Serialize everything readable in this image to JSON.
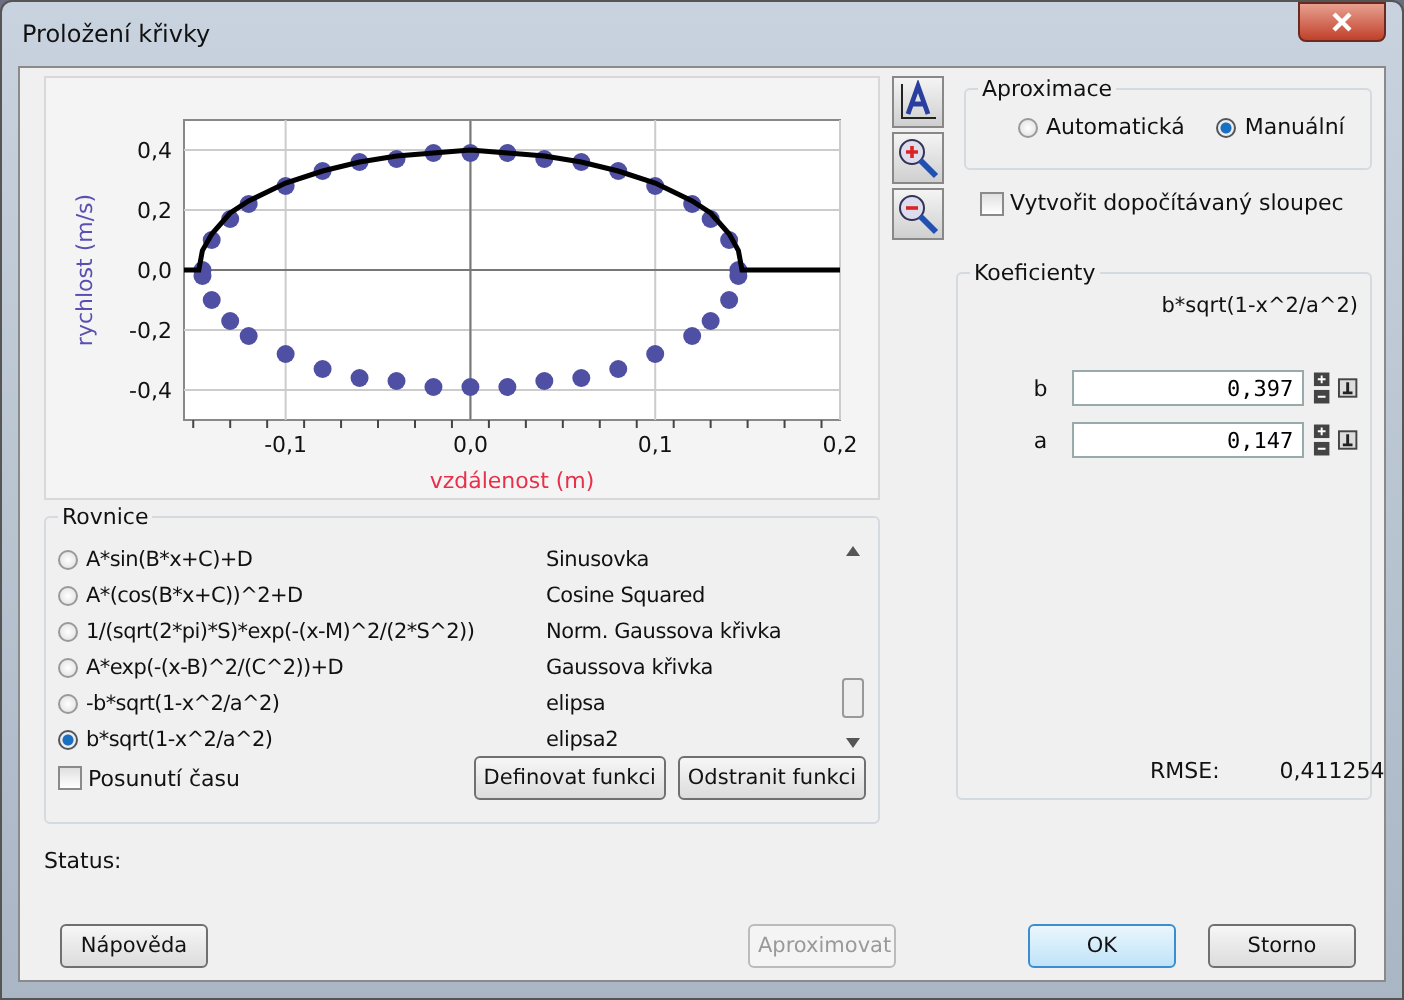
{
  "window": {
    "title": "Proložení křivky"
  },
  "plot": {
    "chart_data": {
      "type": "scatter",
      "grid": true,
      "xlabel": "vzdálenost (m)",
      "ylabel": "rychlost (m/s)",
      "xlim": [
        -0.155,
        0.2
      ],
      "ylim": [
        -0.5,
        0.5
      ],
      "xticks": [
        {
          "value": -0.1,
          "label": "-0,1"
        },
        {
          "value": 0,
          "label": "0,0"
        },
        {
          "value": 0.1,
          "label": "0,1"
        },
        {
          "value": 0.2,
          "label": "0,2"
        }
      ],
      "yticks": [
        {
          "value": -0.4,
          "label": "-0,4"
        },
        {
          "value": -0.2,
          "label": "-0,2"
        },
        {
          "value": 0,
          "label": "0,0"
        },
        {
          "value": 0.2,
          "label": "0,2"
        },
        {
          "value": 0.4,
          "label": "0,4"
        }
      ],
      "x": [
        -0.155,
        -0.147,
        -0.145,
        -0.14,
        -0.13,
        -0.12,
        -0.1,
        -0.08,
        -0.06,
        -0.04,
        -0.02,
        0,
        0.02,
        0.04,
        0.06,
        0.08,
        0.1,
        0.12,
        0.13,
        0.14,
        0.145,
        0.147,
        0.2
      ],
      "series": [
        {
          "type": "scatter",
          "color": "#4f4fa3",
          "values": [
            null,
            null,
            0,
            0.1,
            0.17,
            0.22,
            0.28,
            0.33,
            0.36,
            0.37,
            0.39,
            0.39,
            0.39,
            0.37,
            0.36,
            0.33,
            0.28,
            0.22,
            0.17,
            0.1,
            0,
            null,
            null
          ]
        },
        {
          "type": "scatter",
          "color": "#4f4fa3",
          "values": [
            null,
            null,
            -0.02,
            -0.1,
            -0.17,
            -0.22,
            -0.28,
            -0.33,
            -0.36,
            -0.37,
            -0.39,
            -0.39,
            -0.39,
            -0.37,
            -0.36,
            -0.33,
            -0.28,
            -0.22,
            -0.17,
            -0.1,
            -0.02,
            null,
            null
          ]
        },
        {
          "type": "line",
          "color": "#000000",
          "values": [
            0,
            0,
            0.065,
            0.12,
            0.19,
            0.23,
            0.29,
            0.33,
            0.36,
            0.38,
            0.39,
            0.4,
            0.39,
            0.38,
            0.36,
            0.33,
            0.29,
            0.23,
            0.19,
            0.12,
            0.065,
            0,
            0
          ]
        }
      ]
    }
  },
  "approximation": {
    "title": "Aproximace",
    "options": [
      {
        "label": "Automatická",
        "selected": false
      },
      {
        "label": "Manuální",
        "selected": true
      }
    ]
  },
  "create_column": {
    "label": "Vytvořit dopočítávaný sloupec",
    "checked": false
  },
  "coefficients": {
    "title": "Koeficienty",
    "formula": "b*sqrt(1-x^2/a^2)",
    "items": [
      {
        "name": "b",
        "value": "0,397"
      },
      {
        "name": "a",
        "value": "0,147"
      }
    ],
    "rmse_label": "RMSE:",
    "rmse_value": "0,411254"
  },
  "equations": {
    "title": "Rovnice",
    "items": [
      {
        "formula": "A*sin(B*x+C)+D",
        "name": "Sinusovka",
        "selected": false
      },
      {
        "formula": "A*(cos(B*x+C))^2+D",
        "name": "Cosine Squared",
        "selected": false
      },
      {
        "formula": "1/(sqrt(2*pi)*S)*exp(-(x-M)^2/(2*S^2))",
        "name": "Norm. Gaussova křivka",
        "selected": false
      },
      {
        "formula": "A*exp(-(x-B)^2/(C^2))+D",
        "name": "Gaussova křivka",
        "selected": false
      },
      {
        "formula": "-b*sqrt(1-x^2/a^2)",
        "name": "elipsa",
        "selected": false
      },
      {
        "formula": "b*sqrt(1-x^2/a^2)",
        "name": "elipsa2",
        "selected": true
      }
    ],
    "time_shift": {
      "label": "Posunutí času",
      "checked": false
    },
    "buttons": [
      "Definovat funkci",
      "Odstranit funkci"
    ]
  },
  "status": {
    "label": "Status:"
  },
  "buttons": [
    {
      "label": "Nápověda",
      "disabled": false,
      "default": false
    },
    {
      "label": "Aproximovat",
      "disabled": true,
      "default": false
    },
    {
      "label": "OK",
      "disabled": false,
      "default": true
    },
    {
      "label": "Storno",
      "disabled": false,
      "default": false
    }
  ]
}
